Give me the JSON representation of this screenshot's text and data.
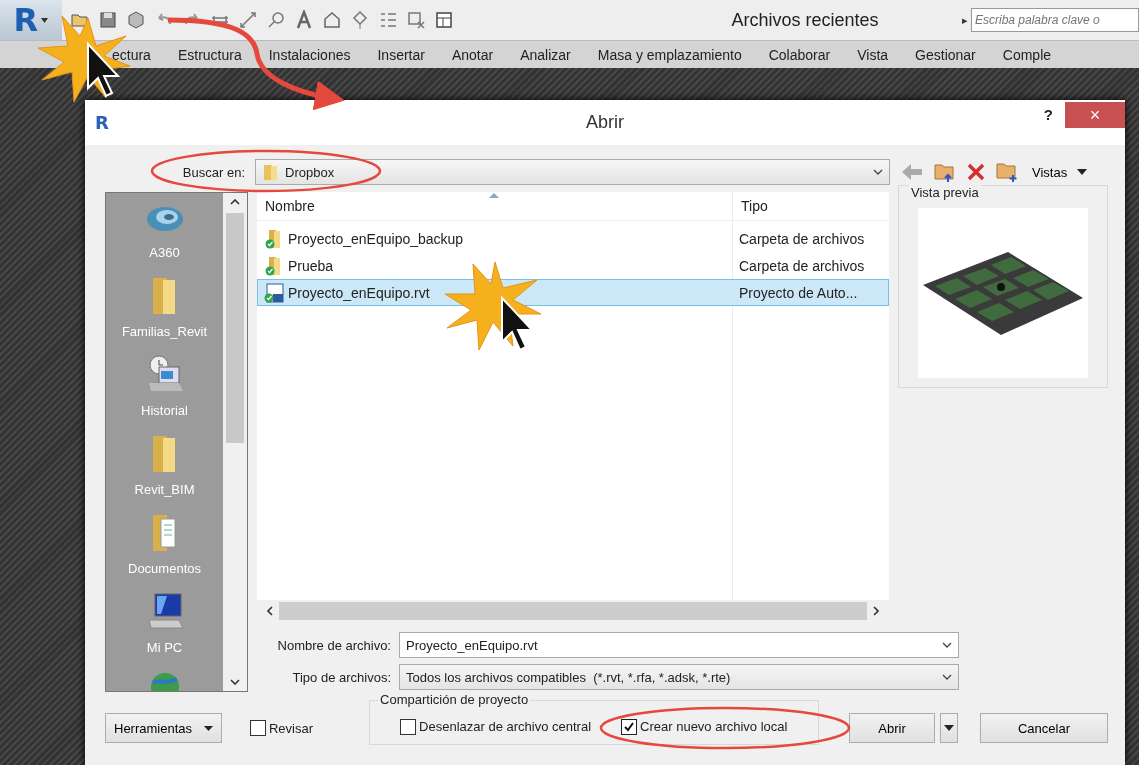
{
  "app": {
    "logo": "R",
    "title": "Archivos recientes",
    "search": {
      "arrow": "▸",
      "placeholder": "Escriba palabra clave o"
    },
    "ribbon_tabs": [
      "ectura",
      "Estructura",
      "Instalaciones",
      "Insertar",
      "Anotar",
      "Analizar",
      "Masa y emplazamiento",
      "Colaborar",
      "Vista",
      "Gestionar",
      "Comple"
    ]
  },
  "dialog": {
    "logo": "R",
    "title": "Abrir",
    "help": "?",
    "close": "×",
    "look_in": {
      "label": "Buscar en:",
      "value": "Dropbox"
    },
    "views_menu": "Vistas",
    "places": [
      {
        "kind": "cloud",
        "label": "A360"
      },
      {
        "kind": "folder",
        "label": "Familias_Revit"
      },
      {
        "kind": "history",
        "label": "Historial"
      },
      {
        "kind": "folder",
        "label": "Revit_BIM"
      },
      {
        "kind": "documents",
        "label": "Documentos"
      },
      {
        "kind": "computer",
        "label": "Mi PC"
      },
      {
        "kind": "network"
      }
    ],
    "columns": [
      "Nombre",
      "Tipo"
    ],
    "files": [
      {
        "kind": "folder",
        "name": "Proyecto_enEquipo_backup",
        "type": "Carpeta de archivos",
        "selected": false
      },
      {
        "kind": "folder",
        "name": "Prueba",
        "type": "Carpeta de archivos",
        "selected": false
      },
      {
        "kind": "project",
        "name": "Proyecto_enEquipo.rvt",
        "type": "Proyecto de Auto...",
        "selected": true
      }
    ],
    "preview": {
      "title": "Vista previa",
      "kind": "picture"
    },
    "file_name": {
      "label": "Nombre de archivo:",
      "value": "Proyecto_enEquipo.rvt"
    },
    "file_type": {
      "label": "Tipo de archivos:",
      "value": "Todos los archivos compatibles  (*.rvt, *.rfa, *.adsk, *.rte)"
    },
    "tools_button": "Herramientas",
    "review": {
      "label": "Revisar",
      "checked": false
    },
    "sharing": {
      "title": "Compartición de proyecto",
      "options": [
        {
          "label": "Desenlazar de archivo central",
          "checked": false
        },
        {
          "label": "Crear nuevo archivo local",
          "checked": true
        }
      ]
    },
    "buttons": [
      "Abrir",
      "Cancelar"
    ]
  }
}
